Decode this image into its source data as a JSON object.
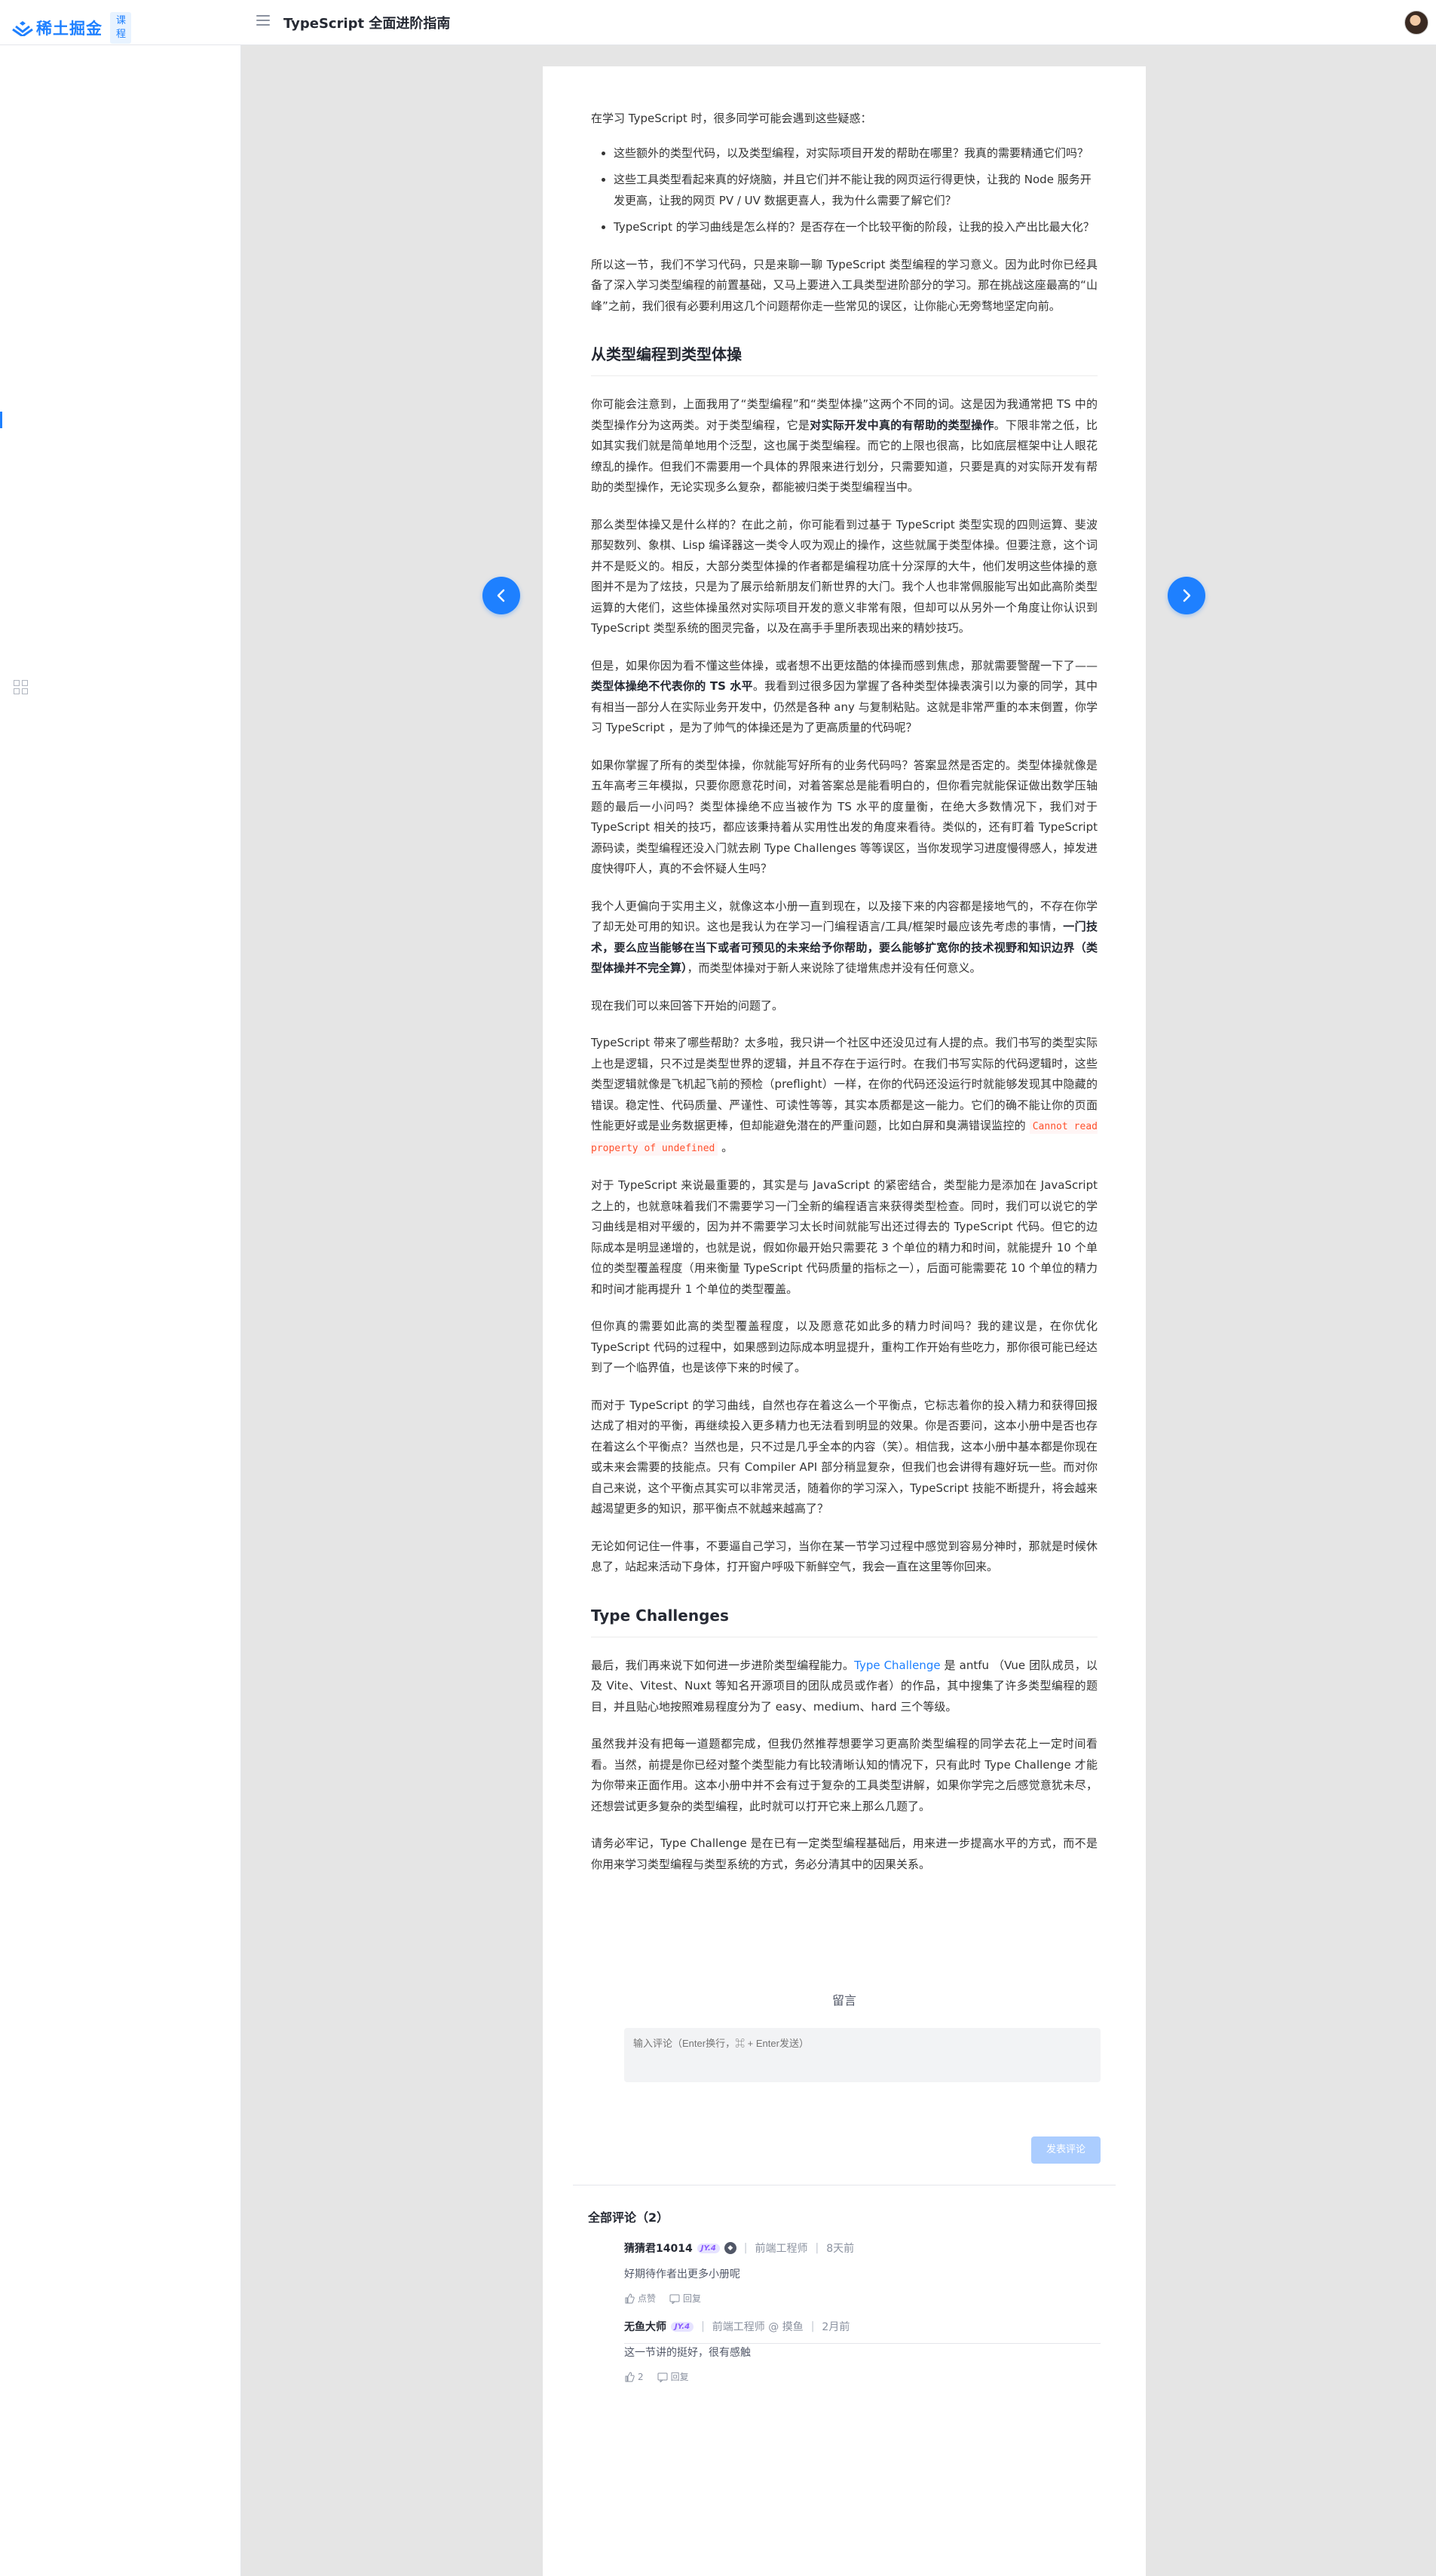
{
  "header": {
    "logo_text": "稀土掘金",
    "logo_badge": "课程",
    "book_title": "TypeScript 全面进阶指南"
  },
  "article": {
    "intro": "在学习 TypeScript 时，很多同学可能会遇到这些疑惑：",
    "questions": [
      "这些额外的类型代码，以及类型编程，对实际项目开发的帮助在哪里？我真的需要精通它们吗？",
      "这些工具类型看起来真的好烧脑，并且它们并不能让我的网页运行得更快，让我的 Node 服务开发更高，让我的网页 PV / UV 数据更喜人，我为什么需要了解它们？",
      "TypeScript 的学习曲线是怎么样的？是否存在一个比较平衡的阶段，让我的投入产出比最大化？"
    ],
    "p_intro2": "所以这一节，我们不学习代码，只是来聊一聊 TypeScript 类型编程的学习意义。因为此时你已经具备了深入学习类型编程的前置基础，又马上要进入工具类型进阶部分的学习。那在挑战这座最高的“山峰”之前，我们很有必要利用这几个问题帮你走一些常见的误区，让你能心无旁骛地坚定向前。",
    "h2_1": "从类型编程到类型体操",
    "p1_a": "你可能会注意到，上面我用了“类型编程”和“类型体操”这两个不同的词。这是因为我通常把 TS 中的类型操作分为这两类。对于类型编程，它是",
    "p1_b": "对实际开发中真的有帮助的类型操作",
    "p1_c": "。下限非常之低，比如其实我们就是简单地用个泛型，这也属于类型编程。而它的上限也很高，比如底层框架中让人眼花缭乱的操作。但我们不需要用一个具体的界限来进行划分，只需要知道，只要是真的对实际开发有帮助的类型操作，无论实现多么复杂，都能被归类于类型编程当中。",
    "p2": "那么类型体操又是什么样的？在此之前，你可能看到过基于 TypeScript 类型实现的四则运算、斐波那契数列、象棋、Lisp 编译器这一类令人叹为观止的操作，这些就属于类型体操。但要注意，这个词并不是贬义的。相反，大部分类型体操的作者都是编程功底十分深厚的大牛，他们发明这些体操的意图并不是为了炫技，只是为了展示给新朋友们新世界的大门。我个人也非常佩服能写出如此高阶类型运算的大佬们，这些体操虽然对实际项目开发的意义非常有限，但却可以从另外一个角度让你认识到 TypeScript 类型系统的图灵完备，以及在高手手里所表现出来的精妙技巧。",
    "p3_a": "但是，如果你因为看不懂这些体操，或者想不出更炫酷的体操而感到焦虑，那就需要警醒一下了——",
    "p3_b": "类型体操绝不代表你的 TS 水平",
    "p3_c": "。我看到过很多因为掌握了各种类型体操表演引以为豪的同学，其中有相当一部分人在实际业务开发中，仍然是各种 any 与复制粘贴。这就是非常严重的本末倒置，你学习 TypeScript ，是为了帅气的体操还是为了更高质量的代码呢？",
    "p4": "如果你掌握了所有的类型体操，你就能写好所有的业务代码吗？答案显然是否定的。类型体操就像是五年高考三年模拟，只要你愿意花时间，对着答案总是能看明白的，但你看完就能保证做出数学压轴题的最后一小问吗？类型体操绝不应当被作为 TS 水平的度量衡，在绝大多数情况下，我们对于 TypeScript 相关的技巧，都应该秉持着从实用性出发的角度来看待。类似的，还有盯着 TypeScript 源码读，类型编程还没入门就去刷 Type Challenges 等等误区，当你发现学习进度慢得感人，掉发进度快得吓人，真的不会怀疑人生吗？",
    "p5_a": "我个人更偏向于实用主义，就像这本小册一直到现在，以及接下来的内容都是接地气的，不存在你学了却无处可用的知识。这也是我认为在学习一门编程语言/工具/框架时最应该先考虑的事情，",
    "p5_b": "一门技术，要么应当能够在当下或者可预见的未来给予你帮助，要么能够扩宽你的技术视野和知识边界（类型体操并不完全算）",
    "p5_c": "，而类型体操对于新人来说除了徒增焦虑并没有任何意义。",
    "p6": "现在我们可以来回答下开始的问题了。",
    "p7_a": "TypeScript 带来了哪些帮助？太多啦，我只讲一个社区中还没见过有人提的点。我们书写的类型实际上也是逻辑，只不过是类型世界的逻辑，并且不存在于运行时。在我们书写实际的代码逻辑时，这些类型逻辑就像是飞机起飞前的预检（preflight）一样，在你的代码还没运行时就能够发现其中隐藏的错误。稳定性、代码质量、严谨性、可读性等等，其实本质都是这一能力。它们的确不能让你的页面性能更好或是业务数据更棒，但却能避免潜在的严重问题，比如白屏和臭满错误监控的",
    "p7_code": "Cannot read property of undefined",
    "p7_c": "。",
    "p8": "对于 TypeScript 来说最重要的，其实是与 JavaScript 的紧密结合，类型能力是添加在 JavaScript 之上的，也就意味着我们不需要学习一门全新的编程语言来获得类型检查。同时，我们可以说它的学习曲线是相对平缓的，因为并不需要学习太长时间就能写出还过得去的 TypeScript 代码。但它的边际成本是明显递增的，也就是说，假如你最开始只需要花 3 个单位的精力和时间，就能提升 10 个单位的类型覆盖程度（用来衡量 TypeScript 代码质量的指标之一），后面可能需要花 10 个单位的精力和时间才能再提升 1 个单位的类型覆盖。",
    "p9": "但你真的需要如此高的类型覆盖程度，以及愿意花如此多的精力时间吗？我的建议是，在你优化 TypeScript 代码的过程中，如果感到边际成本明显提升，重构工作开始有些吃力，那你很可能已经达到了一个临界值，也是该停下来的时候了。",
    "p10": "而对于 TypeScript 的学习曲线，自然也存在着这么一个平衡点，它标志着你的投入精力和获得回报达成了相对的平衡，再继续投入更多精力也无法看到明显的效果。你是否要问，这本小册中是否也存在着这么个平衡点？当然也是，只不过是几乎全本的内容（笑）。相信我，这本小册中基本都是你现在或未来会需要的技能点。只有 Compiler API 部分稍显复杂，但我们也会讲得有趣好玩一些。而对你自己来说，这个平衡点其实可以非常灵活，随着你的学习深入，TypeScript 技能不断提升，将会越来越渴望更多的知识，那平衡点不就越来越高了？",
    "p11": "无论如何记住一件事，不要逼自己学习，当你在某一节学习过程中感觉到容易分神时，那就是时候休息了，站起来活动下身体，打开窗户呼吸下新鲜空气，我会一直在这里等你回来。",
    "h2_2": "Type Challenges",
    "p12_a": "最后，我们再来说下如何进一步进阶类型编程能力。",
    "p12_link": "Type Challenge",
    "p12_c": "是 antfu （Vue 团队成员，以及 Vite、Vitest、Nuxt 等知名开源项目的团队成员或作者）的作品，其中搜集了许多类型编程的题目，并且贴心地按照难易程度分为了 easy、medium、hard 三个等级。",
    "p13": "虽然我并没有把每一道题都完成，但我仍然推荐想要学习更高阶类型编程的同学去花上一定时间看看。当然，前提是你已经对整个类型能力有比较清晰认知的情况下，只有此时 Type Challenge 才能为你带来正面作用。这本小册中并不会有过于复杂的工具类型讲解，如果你学完之后感觉意犹未尽，还想尝试更多复杂的类型编程，此时就可以打开它来上那么几题了。",
    "p14": "请务必牢记，Type Challenge 是在已有一定类型编程基础后，用来进一步提高水平的方式，而不是你用来学习类型编程与类型系统的方式，务必分清其中的因果关系。"
  },
  "comments": {
    "section_title": "留言",
    "input_placeholder": "输入评论（Enter换行，⌘ + Enter发送）",
    "publish_label": "发表评论",
    "all_label": "全部评论（2）",
    "items": [
      {
        "name": "猜猜君14014",
        "level": "JY.4",
        "badge": "◆",
        "job": "前端工程师",
        "time": "8天前",
        "text": "好期待作者出更多小册呢",
        "like": "点赞",
        "reply": "回复"
      },
      {
        "name": "无鱼大师",
        "level": "JY.4",
        "job": "前端工程师 @ 摸鱼",
        "time": "2月前",
        "text": "这一节讲的挺好，很有感触",
        "like": "2",
        "reply": "回复"
      }
    ]
  },
  "colors": {
    "accent": "#1e80ff",
    "background": "#e5e5e5",
    "code": "#ff502c"
  }
}
